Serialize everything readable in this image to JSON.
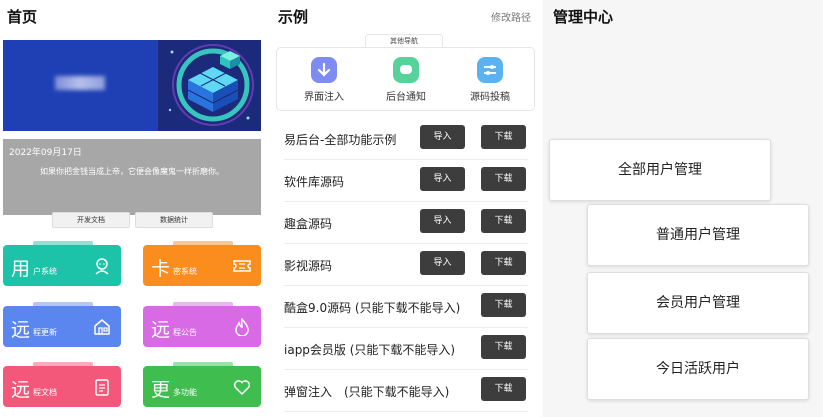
{
  "home": {
    "title": "首页",
    "date": "2022年09月17日",
    "quote": "如果你把金钱当成上帝，它便会像魔鬼一样折磨你。",
    "buttons": {
      "docs": "开发文档",
      "stats": "数据统计"
    },
    "tiles": [
      {
        "big": "用",
        "small": "户系统",
        "color": "#1dc3a8",
        "tab": "#8fe3d5",
        "icon": "user-icon"
      },
      {
        "big": "卡",
        "small": "密系统",
        "color": "#fb8c1e",
        "tab": "#fdc68e",
        "icon": "ticket-icon"
      },
      {
        "big": "远",
        "small": "程更新",
        "color": "#5b86f0",
        "tab": "#b3c7f7",
        "icon": "home-icon"
      },
      {
        "big": "远",
        "small": "程公告",
        "color": "#d96ae6",
        "tab": "#ecb4f2",
        "icon": "fire-icon"
      },
      {
        "big": "远",
        "small": "程文档",
        "color": "#f3587a",
        "tab": "#f9abbc",
        "icon": "document-icon"
      },
      {
        "big": "更",
        "small": "多功能",
        "color": "#3fbe4f",
        "tab": "#9fdea7",
        "icon": "heart-icon"
      }
    ]
  },
  "examples": {
    "title": "示例",
    "edit_link": "修改路径",
    "nav_tab": "其他导航",
    "nav_items": [
      {
        "label": "界面注入",
        "color": "#7d8bf2",
        "icon": "download-arrow-icon"
      },
      {
        "label": "后台通知",
        "color": "#56d29a",
        "icon": "chat-bubble-icon"
      },
      {
        "label": "源码投稿",
        "color": "#5ab2f3",
        "icon": "sliders-icon"
      }
    ],
    "import_label": "导入",
    "download_label": "下载",
    "rows": [
      {
        "name": "易后台-全部功能示例"
      },
      {
        "name": "软件库源码"
      },
      {
        "name": "趣盒源码"
      },
      {
        "name": "影视源码"
      },
      {
        "name": "酷盒9.0源码 (只能下载不能导入)"
      },
      {
        "name": "iapp会员版 (只能下载不能导入)"
      },
      {
        "name": "弹窗注入　(只能下载不能导入)"
      }
    ]
  },
  "admin": {
    "title": "管理中心",
    "buttons": [
      {
        "label": "全部用户管理"
      },
      {
        "label": "普通用户管理"
      },
      {
        "label": "会员用户管理"
      },
      {
        "label": "今日活跃用户"
      }
    ]
  }
}
